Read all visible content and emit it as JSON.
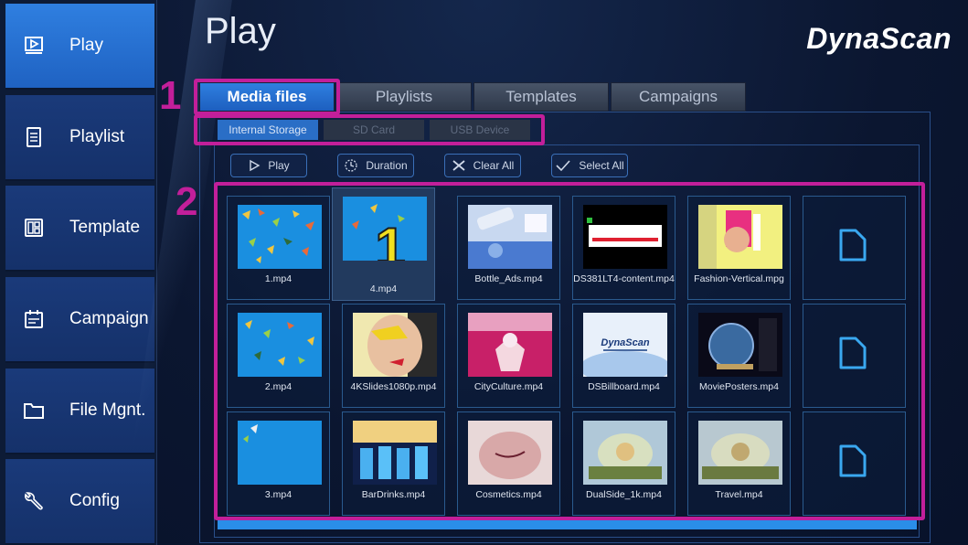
{
  "app": {
    "page_title": "Play",
    "brand": "DynaScan"
  },
  "sidebar": {
    "items": [
      {
        "label": "Play",
        "icon": "play-screen-icon",
        "active": true
      },
      {
        "label": "Playlist",
        "icon": "list-doc-icon",
        "active": false
      },
      {
        "label": "Template",
        "icon": "template-layout-icon",
        "active": false
      },
      {
        "label": "Campaign",
        "icon": "calendar-icon",
        "active": false
      },
      {
        "label": "File Mgnt.",
        "icon": "folder-icon",
        "active": false
      },
      {
        "label": "Config",
        "icon": "wrench-icon",
        "active": false
      }
    ]
  },
  "tabs": [
    {
      "label": "Media files",
      "active": true
    },
    {
      "label": "Playlists",
      "active": false
    },
    {
      "label": "Templates",
      "active": false
    },
    {
      "label": "Campaigns",
      "active": false
    }
  ],
  "storage_tabs": [
    {
      "label": "Internal Storage",
      "active": true
    },
    {
      "label": "SD Card",
      "active": false
    },
    {
      "label": "USB Device",
      "active": false
    }
  ],
  "actions": {
    "play": "Play",
    "duration": "Duration",
    "clear_all": "Clear All",
    "select_all": "Select All"
  },
  "media": [
    [
      "1.mp4",
      "4.mp4",
      "Bottle_Ads.mp4",
      "DS381LT4-content.mp4",
      "Fashion-Vertical.mpg",
      ""
    ],
    [
      "2.mp4",
      "4KSlides1080p.mp4",
      "CityCulture.mp4",
      "DSBillboard.mp4",
      "MoviePosters.mp4",
      ""
    ],
    [
      "3.mp4",
      "BarDrinks.mp4",
      "Cosmetics.mp4",
      "DualSide_1k.mp4",
      "Travel.mp4",
      ""
    ]
  ],
  "selected_media": "4.mp4",
  "thumb_big_number": "1",
  "billboard_text": "DynaScan",
  "annotations": [
    "1",
    "2"
  ],
  "scroll_progress": 1.0,
  "colors": {
    "accent": "#2f7fe0",
    "annotation": "#c21f9a",
    "sidebar": "#15316a"
  }
}
